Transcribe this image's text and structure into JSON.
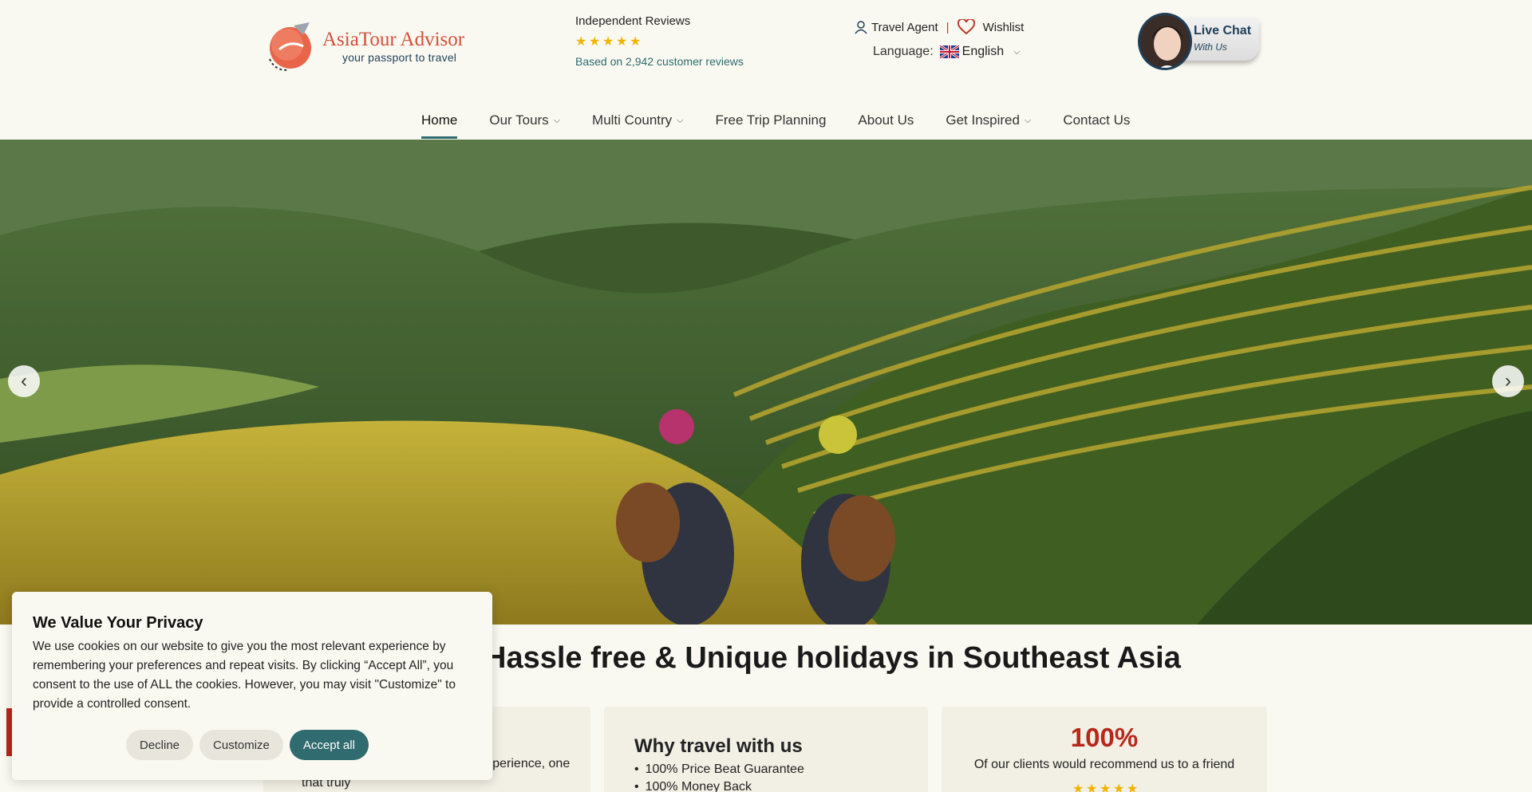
{
  "brand": {
    "name": "AsiaTour Advisor",
    "tagline": "your passport to travel",
    "accent_color": "#d1503a",
    "teal_color": "#2f6b6f"
  },
  "reviews": {
    "title": "Independent Reviews",
    "rating": 5,
    "subtitle": "Based on 2,942 customer reviews"
  },
  "top_links": {
    "travel_agent": "Travel Agent",
    "separator": "|",
    "wishlist": "Wishlist",
    "language_label": "Language:",
    "language_value": "English"
  },
  "live_chat": {
    "title": "Live Chat",
    "subtitle": "With Us"
  },
  "nav": {
    "items": [
      {
        "label": "Home",
        "dropdown": false,
        "active": true
      },
      {
        "label": "Our Tours",
        "dropdown": true
      },
      {
        "label": "Multi Country",
        "dropdown": true
      },
      {
        "label": "Free Trip Planning",
        "dropdown": false
      },
      {
        "label": "About Us",
        "dropdown": false
      },
      {
        "label": "Get Inspired",
        "dropdown": true
      },
      {
        "label": "Contact Us",
        "dropdown": false
      }
    ]
  },
  "hero": {
    "prev_icon": "chevron-left-icon",
    "next_icon": "chevron-right-icon"
  },
  "main": {
    "headline": "Hassle free & Unique holidays in Southeast Asia",
    "card1_text": "nts with an unforgettable travel experience, one that truly",
    "card2_title": "Why travel with us",
    "card2_items": [
      "100% Price Beat Guarantee",
      "100% Money Back"
    ],
    "card3_percent": "100%",
    "card3_text": "Of our clients would recommend us to a friend"
  },
  "cookie": {
    "title": "We Value Your Privacy",
    "text": "We use cookies on our website to give you the most relevant experience by remembering your preferences and repeat visits. By clicking “Accept All”, you consent to the use of ALL the cookies. However, you may visit \"Customize\" to provide a controlled consent.",
    "decline": "Decline",
    "customize": "Customize",
    "accept": "Accept all"
  }
}
